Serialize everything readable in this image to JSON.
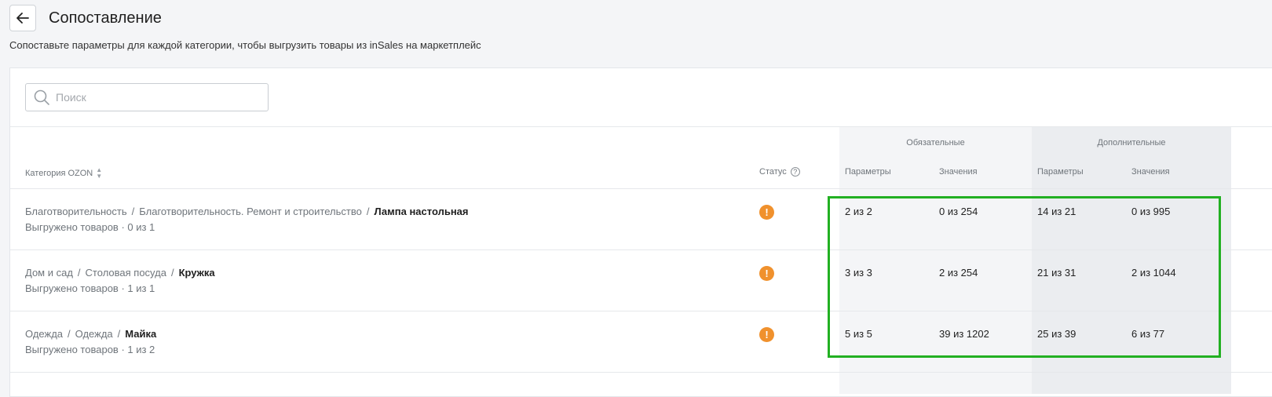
{
  "header": {
    "title": "Сопоставление",
    "subtitle": "Сопоставьте параметры для каждой категории, чтобы выгрузить товары из inSales на маркетплейс"
  },
  "search": {
    "placeholder": "Поиск",
    "value": ""
  },
  "table": {
    "category_header": "Категория OZON",
    "status_header": "Статус",
    "group_mandatory": "Обязательные",
    "group_additional": "Дополнительные",
    "col_params": "Параметры",
    "col_values": "Значения",
    "rows": [
      {
        "path": [
          "Благотворительность",
          "Благотворительность. Ремонт и строительство"
        ],
        "name": "Лампа настольная",
        "exported": "Выгружено товаров · 0 из 1",
        "req_params": "2 из 2",
        "req_values": "0 из 254",
        "add_params": "14 из 21",
        "add_values": "0 из 995"
      },
      {
        "path": [
          "Дом и сад",
          "Столовая посуда"
        ],
        "name": "Кружка",
        "exported": "Выгружено товаров · 1 из 1",
        "req_params": "3 из 3",
        "req_values": "2 из 254",
        "add_params": "21 из 31",
        "add_values": "2 из 1044"
      },
      {
        "path": [
          "Одежда",
          "Одежда"
        ],
        "name": "Майка",
        "exported": "Выгружено товаров · 1 из 2",
        "req_params": "5 из 5",
        "req_values": "39 из 1202",
        "add_params": "25 из 39",
        "add_values": "6 из 77"
      }
    ]
  },
  "colors": {
    "status_warning": "#f0912d",
    "highlight": "#22b022"
  }
}
